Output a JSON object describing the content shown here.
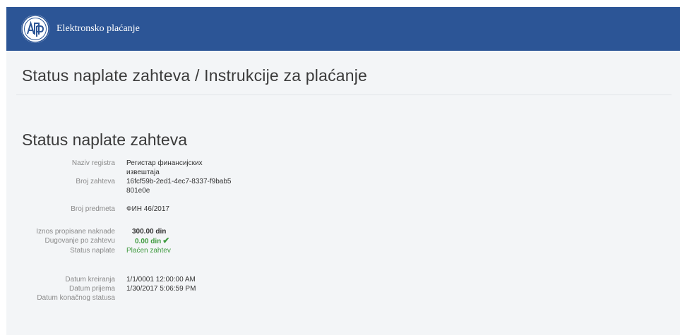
{
  "header": {
    "brand_name": "Elektronsko plaćanje",
    "logo_text": "АПР",
    "accent_color": "#2c5596"
  },
  "page": {
    "title": "Status naplate zahteva / Instrukcije za plaćanje",
    "section_title": "Status naplate zahteva"
  },
  "details": {
    "registry": {
      "label": "Naziv registra",
      "value": "Регистар финансијских извештаја"
    },
    "request_number": {
      "label": "Broj zahteva",
      "value": "16fcf59b-2ed1-4ec7-8337-f9bab5801e0e"
    },
    "case_number": {
      "label": "Broj predmeta",
      "value": "ФИН 46/2017"
    },
    "fee_amount": {
      "label": "Iznos propisane naknade",
      "value": "300.00 din"
    },
    "debt": {
      "label": "Dugovanje po zahtevu",
      "value": "0.00 din",
      "icon": "checkmark-icon"
    },
    "payment_status": {
      "label": "Status naplate",
      "value": "Plaćen zahtev",
      "color": "#3f9a3f"
    },
    "created_date": {
      "label": "Datum kreiranja",
      "value": "1/1/0001 12:00:00 AM"
    },
    "received_date": {
      "label": "Datum prijema",
      "value": "1/30/2017 5:06:59 PM"
    },
    "final_status_date": {
      "label": "Datum konačnog statusa",
      "value": ""
    }
  }
}
